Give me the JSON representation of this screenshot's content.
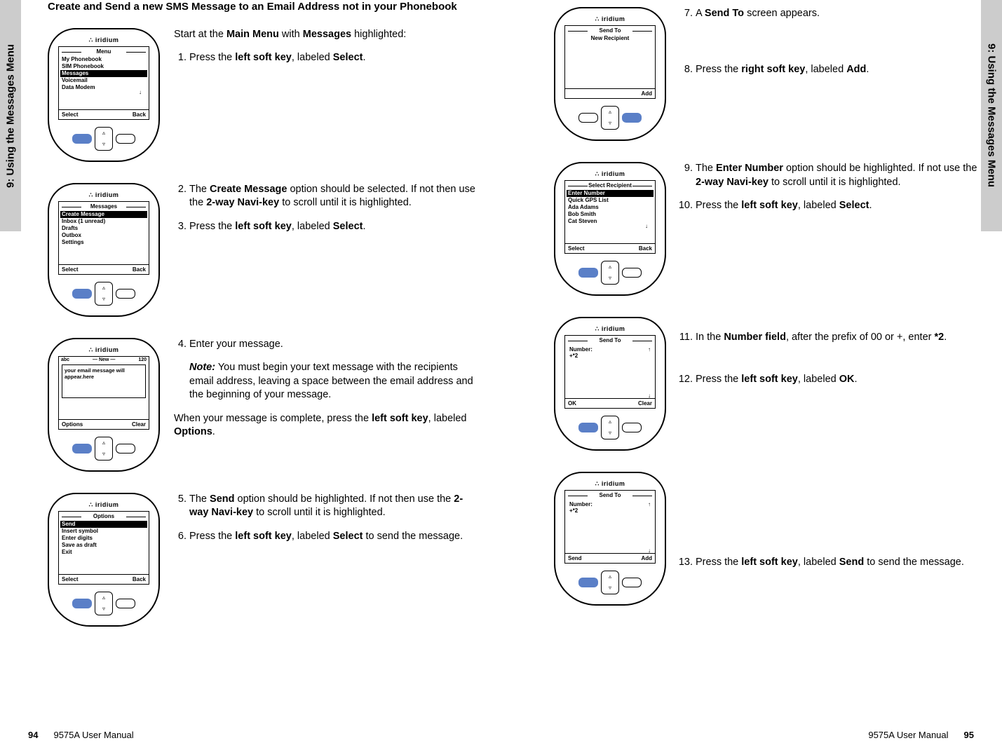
{
  "tab_label": "9: Using the Messages Menu",
  "section_title": "Create and Send a new SMS Message to an Email Address not in your Phonebook",
  "footer_left_page": "94",
  "footer_right_page": "95",
  "footer_manual": "9575A User Manual",
  "devices": {
    "d1": {
      "title": "Menu",
      "items": [
        "My Phonebook",
        "SIM Phonebook",
        "Messages",
        "Voicemail",
        "Data Modem"
      ],
      "highlight_index": 2,
      "sk_left": "Select",
      "sk_right": "Back"
    },
    "d2": {
      "title": "Messages",
      "items": [
        "Create Message",
        "Inbox (1 unread)",
        "Drafts",
        "Outbox",
        "Settings"
      ],
      "highlight_index": 0,
      "sk_left": "Select",
      "sk_right": "Back"
    },
    "d3": {
      "head_left": "abc",
      "head_center": "New",
      "head_right": "120",
      "body": "your email message will appear.here",
      "sk_left": "Options",
      "sk_right": "Clear"
    },
    "d4": {
      "title": "Options",
      "items": [
        "Send",
        "Insert symbol",
        "Enter digits",
        "Save as draft",
        "Exit"
      ],
      "highlight_index": 0,
      "sk_left": "Select",
      "sk_right": "Back"
    },
    "d5": {
      "title": "Send To",
      "items": [
        "New Recipient"
      ],
      "highlight_index": -1,
      "sk_left": "",
      "sk_right": "Add"
    },
    "d6": {
      "title": "Select Recipient",
      "items": [
        "Enter Number",
        "Quick GPS List",
        "Ada Adams",
        "Bob Smith",
        "Cat Steven"
      ],
      "highlight_index": 0,
      "sk_left": "Select",
      "sk_right": "Back"
    },
    "d7": {
      "title": "Send To",
      "field_label": "Number:",
      "field_value": "+*2",
      "sk_left": "OK",
      "sk_right": "Clear"
    },
    "d8": {
      "title": "Send To",
      "field_label": "Number:",
      "field_value": "+*2",
      "sk_left": "Send",
      "sk_right": "Add"
    }
  },
  "steps": {
    "s0a": "Start at the",
    "s0b": "Main Menu",
    "s0c": "with",
    "s0d": "Messages",
    "s0e": "highlighted:",
    "s1a": "Press the",
    "s1b": "left soft key",
    "s1c": ", labeled",
    "s1d": "Select",
    "s1e": ".",
    "s2a": "The",
    "s2b": "Create Message",
    "s2c": "option should be selected. If not then use the",
    "s2d": "2-way Navi-key",
    "s2e": "to scroll until it is highlighted.",
    "s3a": "Press the",
    "s3b": "left soft key",
    "s3c": ", labeled",
    "s3d": "Select",
    "s3e": ".",
    "s4": "Enter your message.",
    "s4note_label": "Note:",
    "s4note": "You must begin your text message with the recipients email address, leaving a space between the email address and the beginning of your message.",
    "s4after_a": "When your message is complete, press the",
    "s4after_b": "left soft key",
    "s4after_c": ", labeled",
    "s4after_d": "Options",
    "s4after_e": ".",
    "s5a": "The",
    "s5b": "Send",
    "s5c": "option should be highlighted. If not then use the",
    "s5d": "2-way Navi-key",
    "s5e": "to scroll until it is highlighted.",
    "s6a": "Press the",
    "s6b": "left soft key",
    "s6c": ", labeled",
    "s6d": "Select",
    "s6e": "to send the message.",
    "s7a": "A",
    "s7b": "Send To",
    "s7c": "screen appears.",
    "s8a": "Press the",
    "s8b": "right soft key",
    "s8c": ", labeled",
    "s8d": "Add",
    "s8e": ".",
    "s9a": "The",
    "s9b": "Enter Number",
    "s9c": "option should be highlighted. If not use the",
    "s9d": "2-way Navi-key",
    "s9e": "to scroll until it is highlighted.",
    "s10a": "Press the",
    "s10b": "left soft key",
    "s10c": ", labeled",
    "s10d": "Select",
    "s10e": ".",
    "s11a": "In the",
    "s11b": "Number field",
    "s11c": ", after the prefix of 00 or +, enter",
    "s11d": "*2",
    "s11e": ".",
    "s12a": "Press the",
    "s12b": "left soft key",
    "s12c": ", labeled",
    "s12d": "OK",
    "s12e": ".",
    "s13a": "Press the",
    "s13b": "left soft key",
    "s13c": ", labeled",
    "s13d": "Send",
    "s13e": "to send the message."
  }
}
